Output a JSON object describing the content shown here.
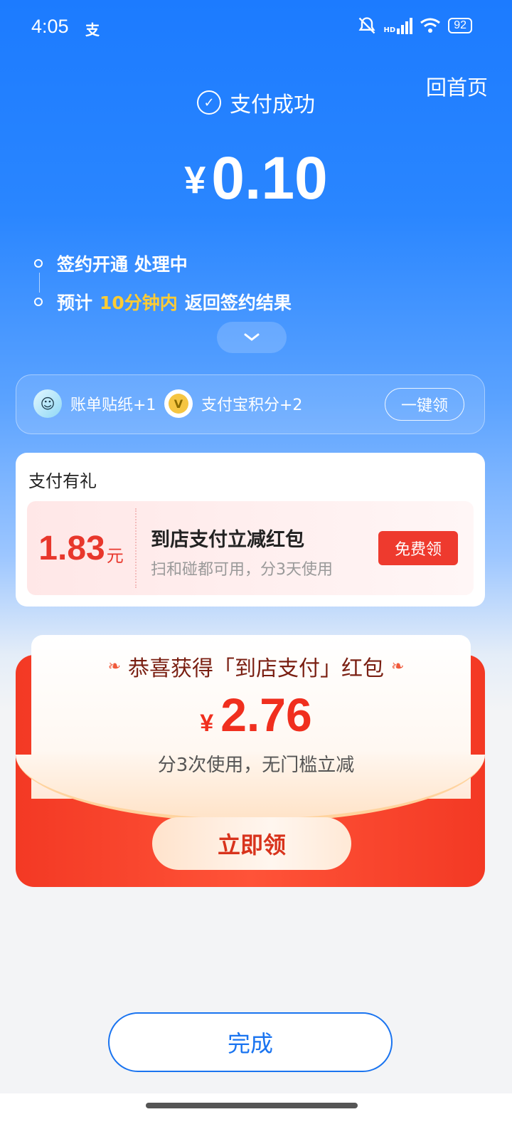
{
  "status_bar": {
    "time": "4:05",
    "app_indicator": "支",
    "battery": "92",
    "signal_label": "HD"
  },
  "header": {
    "home_link": "回首页",
    "success_text": "支付成功"
  },
  "payment": {
    "currency": "¥",
    "amount": "0.10"
  },
  "steps": [
    {
      "text": "签约开通 处理中"
    },
    {
      "prefix": "预计",
      "highlight": "10分钟内",
      "suffix": "返回签约结果"
    }
  ],
  "rewards": {
    "sticker_label": "账单贴纸+1",
    "points_label": "支付宝积分+2",
    "claim_all_label": "一键领"
  },
  "gift": {
    "title": "支付有礼",
    "coupon_value": "1.83",
    "coupon_unit": "元",
    "coupon_name": "到店支付立减红包",
    "coupon_desc": "扫和碰都可用，分3天使用",
    "free_button": "免费领"
  },
  "red_packet": {
    "title": "恭喜获得「到店支付」红包",
    "currency": "¥",
    "amount": "2.76",
    "subtitle": "分3次使用，无门槛立减",
    "claim_button": "立即领"
  },
  "done_button": "完成",
  "colors": {
    "primary_blue": "#1c7bff",
    "accent_red": "#ee3a2e",
    "highlight_yellow": "#ffcc33"
  }
}
